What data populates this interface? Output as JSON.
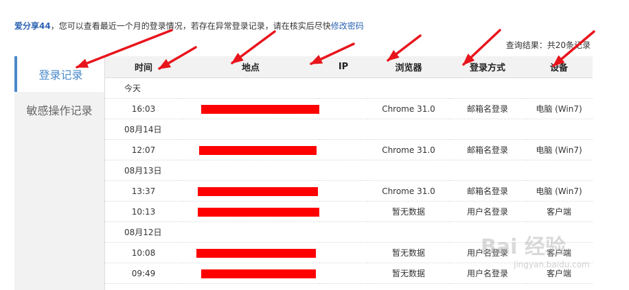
{
  "intro": {
    "username": "爱分享44",
    "message": "，您可以查看最近一个月的登录情况，若存在异常登录记录，请在核实后尽快",
    "link": "修改密码"
  },
  "result_text": "查询结果：共20条记录",
  "sidebar": {
    "items": [
      {
        "label": "登录记录",
        "active": true
      },
      {
        "label": "敏感操作记录",
        "active": false
      }
    ]
  },
  "table": {
    "headers": [
      "时间",
      "地点",
      "IP",
      "浏览器",
      "登录方式",
      "设备"
    ],
    "rows": [
      {
        "date": "今天"
      },
      {
        "time": "16:03",
        "browser": "Chrome 31.0",
        "method": "邮箱名登录",
        "device": "电脑 (Win7)"
      },
      {
        "date": "08月14日"
      },
      {
        "time": "12:07",
        "browser": "Chrome 31.0",
        "method": "邮箱名登录",
        "device": "电脑 (Win7)"
      },
      {
        "date": "08月13日"
      },
      {
        "time": "13:37",
        "browser": "Chrome 31.0",
        "method": "邮箱名登录",
        "device": "电脑 (Win7)"
      },
      {
        "time": "10:13",
        "browser": "暂无数据",
        "method": "用户名登录",
        "device": "客户端"
      },
      {
        "date": "08月12日"
      },
      {
        "time": "10:08",
        "browser": "暂无数据",
        "method": "用户名登录",
        "device": "客户端"
      },
      {
        "time": "09:49",
        "browser": "暂无数据",
        "method": "用户名登录",
        "device": "客户端"
      }
    ]
  },
  "watermark": {
    "logo": "Bai 经验",
    "url": "jingyan.baidu.com"
  },
  "colors": {
    "accent": "#4a88c9",
    "link": "#2d64b3",
    "redaction": "#ff0000",
    "arrow": "#e8141c"
  }
}
